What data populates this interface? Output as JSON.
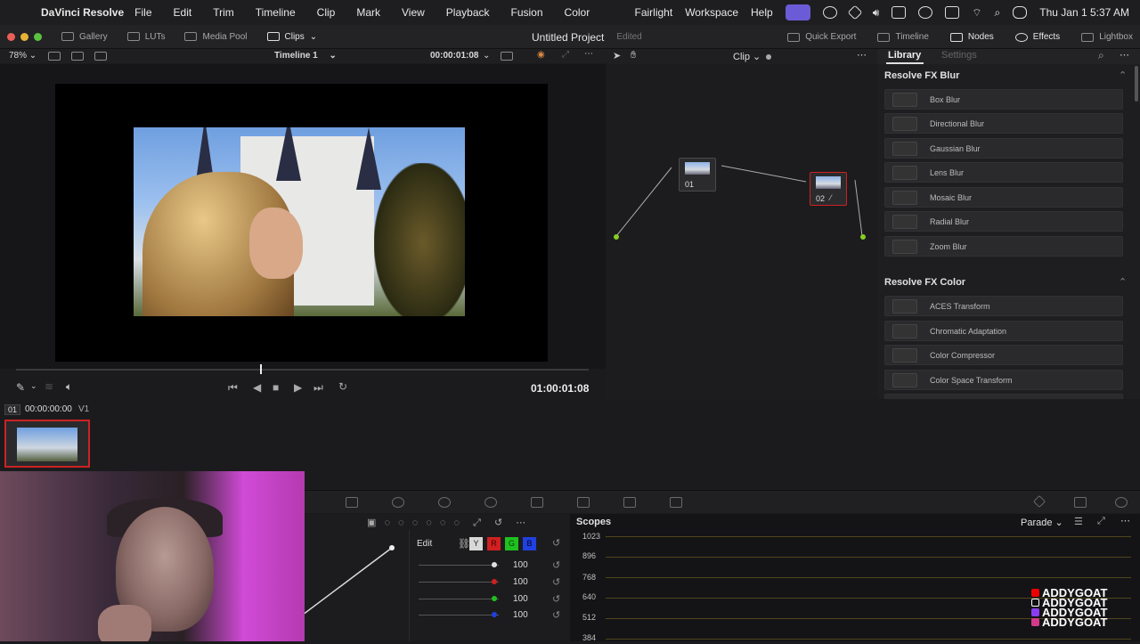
{
  "menubar": {
    "app_name": "DaVinci Resolve",
    "items": [
      "File",
      "Edit",
      "Trim",
      "Timeline",
      "Clip",
      "Mark",
      "View",
      "Playback",
      "Fusion",
      "Color"
    ],
    "right_items": [
      "Fairlight",
      "Workspace",
      "Help"
    ],
    "clock": "Thu Jan 1  5:37 AM"
  },
  "toolbar": {
    "left": [
      "Gallery",
      "LUTs",
      "Media Pool",
      "Clips"
    ],
    "project_title": "Untitled Project",
    "project_status": "Edited",
    "right": [
      "Quick Export",
      "Timeline",
      "Nodes",
      "Effects",
      "Lightbox"
    ]
  },
  "viewer": {
    "zoom": "78%",
    "timeline_name": "Timeline 1",
    "header_timecode": "00:00:01:08",
    "timecode": "01:00:01:08"
  },
  "node_editor": {
    "mode": "Clip",
    "nodes": [
      "01",
      "02"
    ]
  },
  "library": {
    "tabs": [
      "Library",
      "Settings"
    ],
    "groups": [
      {
        "title": "Resolve FX Blur",
        "items": [
          "Box Blur",
          "Directional Blur",
          "Gaussian Blur",
          "Lens Blur",
          "Mosaic Blur",
          "Radial Blur",
          "Zoom Blur"
        ]
      },
      {
        "title": "Resolve FX Color",
        "items": [
          "ACES Transform",
          "Chromatic Adaptation",
          "Color Compressor",
          "Color Space Transform"
        ]
      }
    ]
  },
  "clips": {
    "clip_number": "01",
    "clip_timecode": "00:00:00:00",
    "track": "V1"
  },
  "curves": {
    "edit_label": "Edit",
    "channels": [
      "Y",
      "R",
      "G",
      "B"
    ],
    "values": [
      "100",
      "100",
      "100",
      "100"
    ],
    "colors": [
      "#e0e0e0",
      "#d02020",
      "#20c020",
      "#2040e0"
    ]
  },
  "scopes": {
    "title": "Scopes",
    "mode": "Parade",
    "scale": [
      "1023",
      "896",
      "768",
      "640",
      "512",
      "384"
    ]
  },
  "watermark": {
    "lines": [
      "ADDYGOAT",
      "ADDYGOAT",
      "ADDYGOAT",
      "ADDYGOAT"
    ]
  }
}
